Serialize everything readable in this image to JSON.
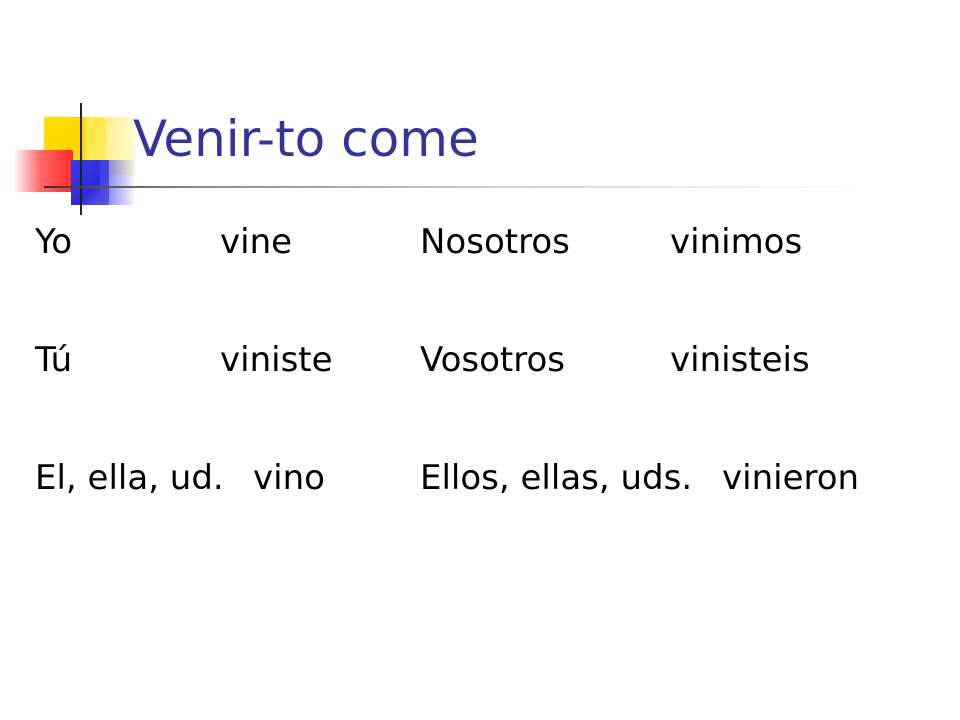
{
  "slide": {
    "title": "Venir-to come",
    "title_color": "#333399",
    "text_color": "#000000",
    "background": "#ffffff"
  },
  "conjugation": {
    "rows": [
      {
        "singular_pronoun": "Yo",
        "singular_form": "vine",
        "plural_pronoun": "Nosotros",
        "plural_form": "vinimos"
      },
      {
        "singular_pronoun": "Tú",
        "singular_form": "viniste",
        "plural_pronoun": "Vosotros",
        "plural_form": "vinisteis"
      },
      {
        "singular_pronoun": "El, ella, ud.",
        "singular_form": "vino",
        "plural_pronoun": "Ellos, ellas, uds.",
        "plural_form": "vinieron"
      }
    ]
  },
  "decoration": {
    "colors": [
      "#ffd400",
      "#ff2a2a",
      "#2b2bd6"
    ]
  }
}
